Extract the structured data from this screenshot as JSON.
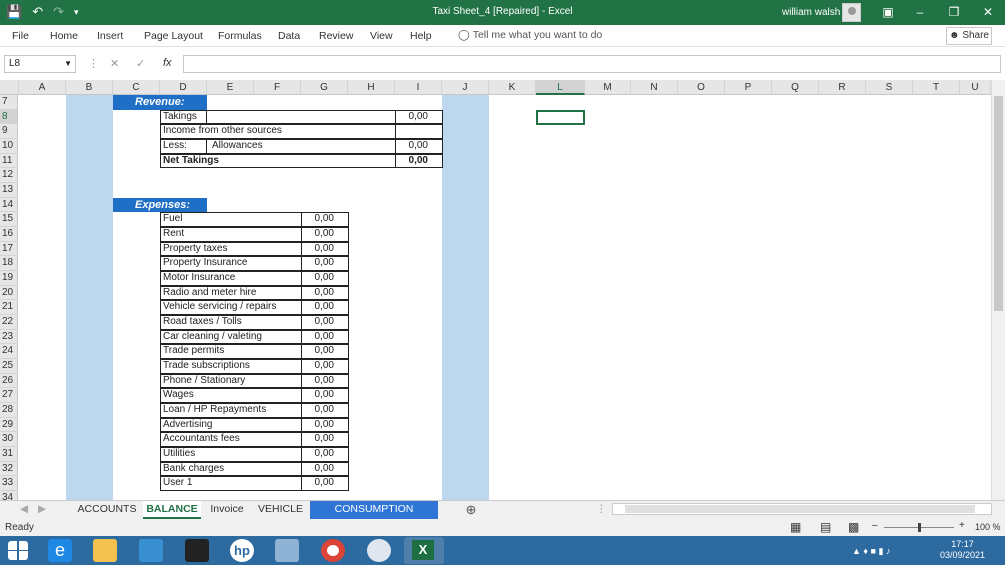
{
  "window": {
    "title": "Taxi Sheet_4 [Repaired]  -  Excel",
    "user": "william walsh",
    "accent": "#217346"
  },
  "menu": [
    "File",
    "Home",
    "Insert",
    "Page Layout",
    "Formulas",
    "Data",
    "Review",
    "View",
    "Help"
  ],
  "tell_me": "Tell me what you want to do",
  "share_label": "Share",
  "namebox": "L8",
  "formula_value": "",
  "columns": [
    "A",
    "B",
    "C",
    "D",
    "E",
    "F",
    "G",
    "H",
    "I",
    "J",
    "K",
    "L",
    "M",
    "N",
    "O",
    "P",
    "Q",
    "R",
    "S",
    "T",
    "U"
  ],
  "rows": [
    "7",
    "8",
    "9",
    "10",
    "11",
    "12",
    "13",
    "14",
    "15",
    "16",
    "17",
    "18",
    "19",
    "20",
    "21",
    "22",
    "23",
    "24",
    "25",
    "26",
    "27",
    "28",
    "29",
    "30",
    "31",
    "32",
    "33",
    "34"
  ],
  "revenue": {
    "header": "Revenue:",
    "takings_label": "Takings",
    "takings_value": "0,00",
    "other_label": "Income from other sources",
    "less_label": "Less:",
    "allowances_label": "Allowances",
    "allowances_value": "0,00",
    "net_label": "Net Takings",
    "net_value": "0,00"
  },
  "expenses": {
    "header": "Expenses:",
    "items": [
      {
        "label": "Fuel",
        "value": "0,00"
      },
      {
        "label": "Rent",
        "value": "0,00"
      },
      {
        "label": "Property taxes",
        "value": "0,00"
      },
      {
        "label": "Property Insurance",
        "value": "0,00"
      },
      {
        "label": "Motor Insurance",
        "value": "0,00"
      },
      {
        "label": "Radio and meter hire",
        "value": "0,00"
      },
      {
        "label": "Vehicle servicing / repairs",
        "value": "0,00"
      },
      {
        "label": "Road taxes / Tolls",
        "value": "0,00"
      },
      {
        "label": "Car cleaning / valeting",
        "value": "0,00"
      },
      {
        "label": "Trade permits",
        "value": "0,00"
      },
      {
        "label": "Trade subscriptions",
        "value": "0,00"
      },
      {
        "label": "Phone / Stationary",
        "value": "0,00"
      },
      {
        "label": "Wages",
        "value": "0,00"
      },
      {
        "label": "Loan / HP Repayments",
        "value": "0,00"
      },
      {
        "label": "Advertising",
        "value": "0,00"
      },
      {
        "label": "Accountants fees",
        "value": "0,00"
      },
      {
        "label": "Utilities",
        "value": "0,00"
      },
      {
        "label": "Bank charges",
        "value": "0,00"
      },
      {
        "label": "User 1",
        "value": "0,00"
      }
    ]
  },
  "sheet_tabs": [
    "ACCOUNTS",
    "BALANCE",
    "Invoice",
    "VEHICLE",
    "CONSUMPTION TRACKER"
  ],
  "active_tab": "BALANCE",
  "status": {
    "ready": "Ready",
    "zoom": "100 %"
  },
  "clock": {
    "time": "17:17",
    "date": "03/09/2021"
  }
}
